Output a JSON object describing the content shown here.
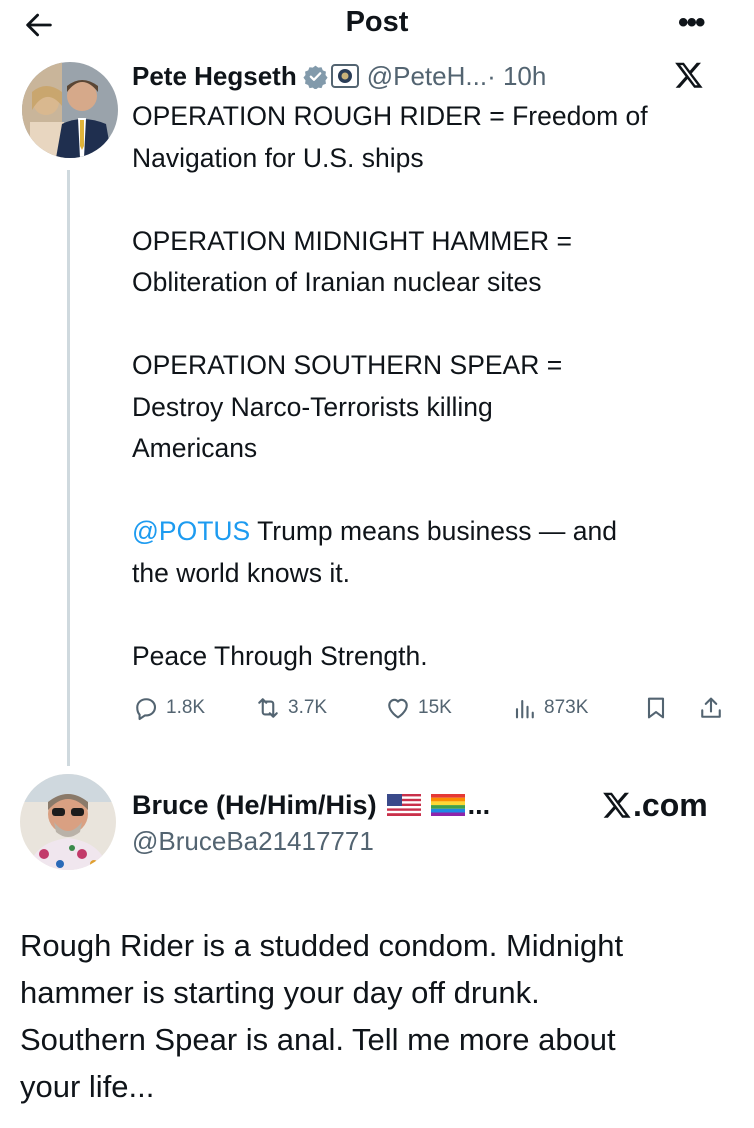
{
  "header": {
    "title": "Post",
    "back_icon": "arrow-left-icon",
    "more_icon": "more-horizontal-icon",
    "more_glyph": "•••"
  },
  "tweet": {
    "author_name": "Pete Hegseth",
    "handle": "@PeteH...",
    "time": " · 10h",
    "paragraphs": [
      [
        "OPERATION ROUGH RIDER = Freedom of",
        "Navigation for U.S. ships"
      ],
      [
        "OPERATION MIDNIGHT HAMMER =",
        "Obliteration of Iranian nuclear sites"
      ],
      [
        "OPERATION SOUTHERN SPEAR =",
        "Destroy Narco-Terrorists killing",
        "Americans"
      ]
    ],
    "mention": "@POTUS",
    "after_mention": " Trump means business — and",
    "after_mention_line2": "the world knows it.",
    "closing": "Peace Through Strength.",
    "metrics": {
      "replies": "1.8K",
      "reposts": "3.7K",
      "likes": "15K",
      "views": "873K"
    }
  },
  "reply": {
    "author_name": "Bruce (He/Him/His)",
    "truncation": "...",
    "handle": "@BruceBa21417771",
    "source": ".com",
    "text_lines": [
      "Rough Rider is a studded condom.  Midnight",
      "hammer is starting your day off drunk.",
      "Southern Spear is anal.  Tell me more about",
      "your life..."
    ]
  },
  "colors": {
    "accent": "#1d9bf0",
    "text": "#0f1419",
    "secondary": "#536471",
    "line": "#cfd9de"
  }
}
